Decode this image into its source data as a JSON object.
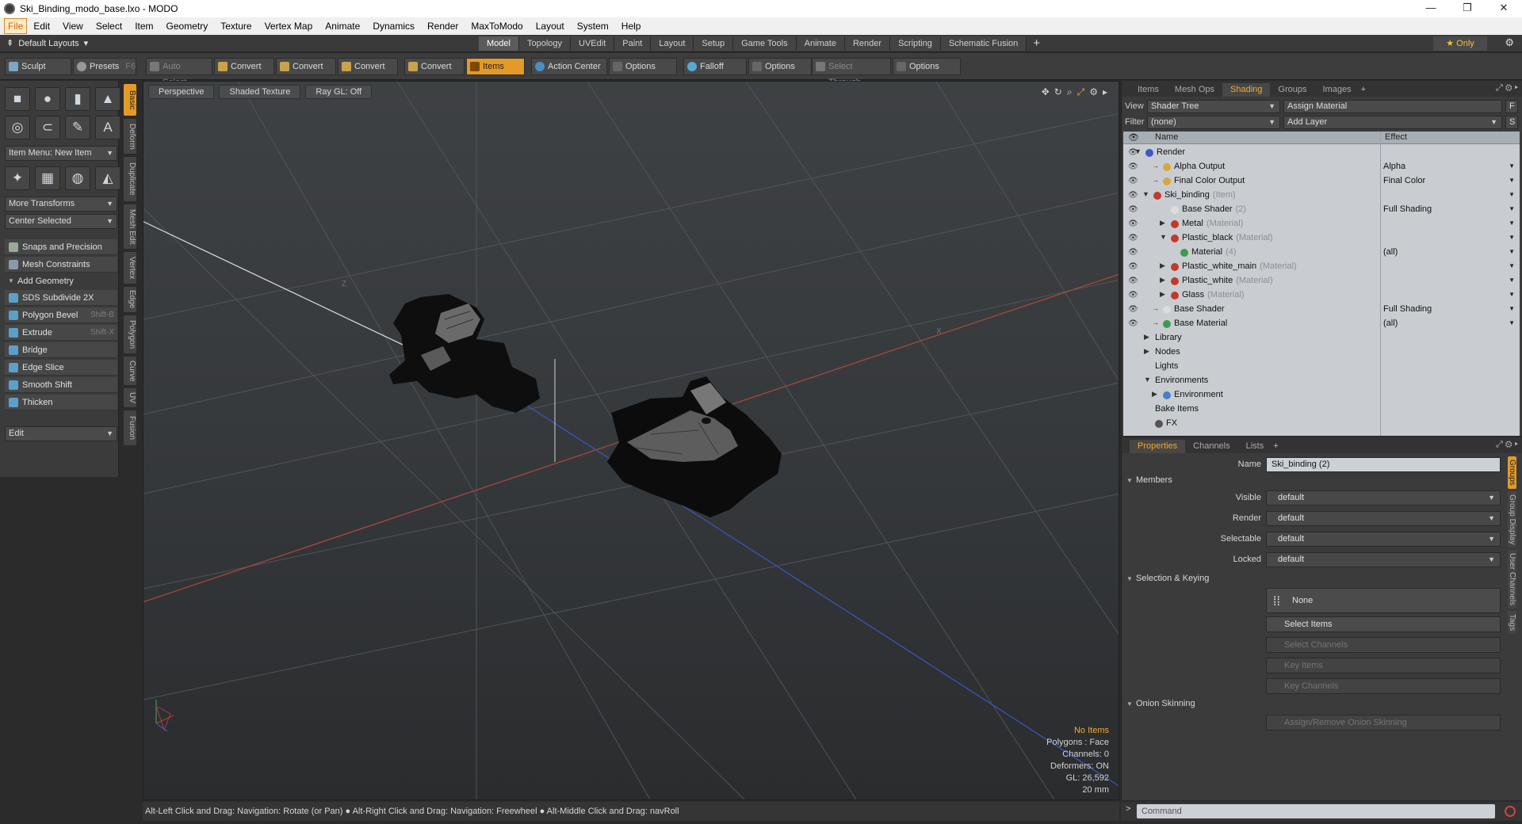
{
  "window": {
    "title": "Ski_Binding_modo_base.lxo - MODO",
    "min": "—",
    "max": "❐",
    "close": "✕"
  },
  "menu": [
    "File",
    "Edit",
    "View",
    "Select",
    "Item",
    "Geometry",
    "Texture",
    "Vertex Map",
    "Animate",
    "Dynamics",
    "Render",
    "MaxToModo",
    "Layout",
    "System",
    "Help"
  ],
  "layoutbar": {
    "default_layouts": "Default Layouts",
    "tabs": [
      "Model",
      "Topology",
      "UVEdit",
      "Paint",
      "Layout",
      "Setup",
      "Game Tools",
      "Animate",
      "Render",
      "Scripting",
      "Schematic Fusion"
    ],
    "active_tab": "Model",
    "only": "Only"
  },
  "toolbar": {
    "sculpt": "Sculpt",
    "presets": "Presets",
    "presets_key": "F6",
    "auto_select": "Auto Select",
    "convert": "Convert",
    "items": "Items",
    "action_center": "Action Center",
    "options": "Options",
    "falloff": "Falloff",
    "select_through": "Select Through"
  },
  "toolbox": {
    "item_menu": "Item Menu: New Item",
    "more_transforms": "More Transforms",
    "center_selected": "Center Selected",
    "snaps": "Snaps and Precision",
    "mesh_constraints": "Mesh Constraints",
    "add_geometry": "Add Geometry",
    "tools": [
      {
        "label": "SDS Subdivide 2X",
        "key": ""
      },
      {
        "label": "Polygon Bevel",
        "key": "Shift-B"
      },
      {
        "label": "Extrude",
        "key": "Shift-X"
      },
      {
        "label": "Bridge",
        "key": ""
      },
      {
        "label": "Edge Slice",
        "key": ""
      },
      {
        "label": "Smooth Shift",
        "key": ""
      },
      {
        "label": "Thicken",
        "key": ""
      }
    ],
    "edit": "Edit",
    "vtabs": [
      "Basic",
      "Deform",
      "Duplicate",
      "Mesh Edit",
      "Vertex",
      "Edge",
      "Polygon",
      "Curve",
      "UV",
      "Fusion"
    ]
  },
  "viewport": {
    "view": "Perspective",
    "shading": "Shaded Texture",
    "raygl": "Ray GL: Off",
    "info": {
      "no_items": "No Items",
      "polygons": "Polygons : Face",
      "channels": "Channels: 0",
      "deformers": "Deformers: ON",
      "gl": "GL: 26,592",
      "scale": "20 mm"
    },
    "axis_z": "Z",
    "axis_x": "X"
  },
  "status": "Alt-Left Click and Drag: Navigation: Rotate (or Pan) ● Alt-Right Click and Drag: Navigation: Freewheel ● Alt-Middle Click and Drag: navRoll",
  "shading_panel": {
    "tabs": [
      "Items",
      "Mesh Ops",
      "Shading",
      "Groups",
      "Images"
    ],
    "active_tab": "Shading",
    "view_label": "View",
    "view_value": "Shader Tree",
    "assign_material": "Assign Material",
    "filter_label": "Filter",
    "filter_value": "(none)",
    "add_layer": "Add Layer",
    "f_btn": "F",
    "s_btn": "S",
    "col_name": "Name",
    "col_effect": "Effect",
    "rows": [
      {
        "name": "Render",
        "sub": "",
        "effect": "",
        "icon": "#3f57c7"
      },
      {
        "name": "Alpha Output",
        "sub": "",
        "effect": "Alpha",
        "icon": "#d6a83a"
      },
      {
        "name": "Final Color Output",
        "sub": "",
        "effect": "Final Color",
        "icon": "#d6a83a"
      },
      {
        "name": "Ski_binding",
        "sub": "(Item)",
        "effect": "",
        "icon": "#c23a2c"
      },
      {
        "name": "Base Shader",
        "sub": "(2)",
        "effect": "Full Shading",
        "icon": "#dddddd"
      },
      {
        "name": "Metal",
        "sub": "(Material)",
        "effect": "",
        "icon": "#c23a2c"
      },
      {
        "name": "Plastic_black",
        "sub": "(Material)",
        "effect": "",
        "icon": "#c23a2c"
      },
      {
        "name": "Material",
        "sub": "(4)",
        "effect": "(all)",
        "icon": "#3e9b4e"
      },
      {
        "name": "Plastic_white_main",
        "sub": "(Material)",
        "effect": "",
        "icon": "#c23a2c"
      },
      {
        "name": "Plastic_white",
        "sub": "(Material)",
        "effect": "",
        "icon": "#c23a2c"
      },
      {
        "name": "Glass",
        "sub": "(Material)",
        "effect": "",
        "icon": "#c23a2c"
      },
      {
        "name": "Base Shader",
        "sub": "",
        "effect": "Full Shading",
        "icon": "#dddddd"
      },
      {
        "name": "Base Material",
        "sub": "",
        "effect": "(all)",
        "icon": "#3e9b4e"
      },
      {
        "name": "Library",
        "sub": "",
        "effect": "",
        "icon": ""
      },
      {
        "name": "Nodes",
        "sub": "",
        "effect": "",
        "icon": ""
      },
      {
        "name": "Lights",
        "sub": "",
        "effect": "",
        "icon": ""
      },
      {
        "name": "Environments",
        "sub": "",
        "effect": "",
        "icon": ""
      },
      {
        "name": "Environment",
        "sub": "",
        "effect": "",
        "icon": "#4a7ec9"
      },
      {
        "name": "Bake Items",
        "sub": "",
        "effect": "",
        "icon": ""
      },
      {
        "name": "FX",
        "sub": "",
        "effect": "",
        "icon": "#555555"
      }
    ]
  },
  "properties_panel": {
    "tabs": [
      "Properties",
      "Channels",
      "Lists"
    ],
    "active_tab": "Properties",
    "name_label": "Name",
    "name_value": "Ski_binding (2)",
    "members": "Members",
    "visible_label": "Visible",
    "render_label": "Render",
    "selectable_label": "Selectable",
    "locked_label": "Locked",
    "default": "default",
    "selection_keying": "Selection & Keying",
    "none": "None",
    "select_items": "Select Items",
    "select_channels": "Select Channels",
    "key_items": "Key Items",
    "key_channels": "Key Channels",
    "onion_skinning": "Onion Skinning",
    "assign_onion": "Assign/Remove Onion Skinning",
    "side_tabs": [
      "Groups",
      "Group Display",
      "User Channels",
      "Tags"
    ]
  },
  "command": {
    "prompt": ">",
    "placeholder": "Command"
  }
}
